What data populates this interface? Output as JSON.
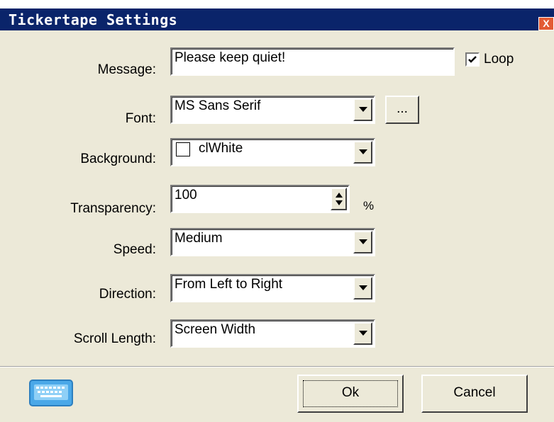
{
  "window": {
    "title": "Tickertape Settings",
    "close_label": "X"
  },
  "form": {
    "message": {
      "label": "Message:",
      "value": "Please keep quiet!"
    },
    "loop": {
      "label": "Loop",
      "checked": true
    },
    "font": {
      "label": "Font:",
      "value": "MS Sans Serif",
      "browse_label": "..."
    },
    "background": {
      "label": "Background:",
      "value": "clWhite",
      "swatch_color": "#ffffff"
    },
    "transparency": {
      "label": "Transparency:",
      "value": "100",
      "unit": "%"
    },
    "speed": {
      "label": "Speed:",
      "value": "Medium"
    },
    "direction": {
      "label": "Direction:",
      "value": "From Left to Right"
    },
    "scroll_length": {
      "label": "Scroll Length:",
      "value": "Screen Width"
    }
  },
  "footer": {
    "ok_label": "Ok",
    "cancel_label": "Cancel",
    "icon": "keyboard-icon"
  },
  "colors": {
    "title_bar": "#0a246a",
    "dialog_bg": "#ece9d8",
    "close_button": "#e35b34",
    "keyboard_icon": "#4aa8e8"
  }
}
